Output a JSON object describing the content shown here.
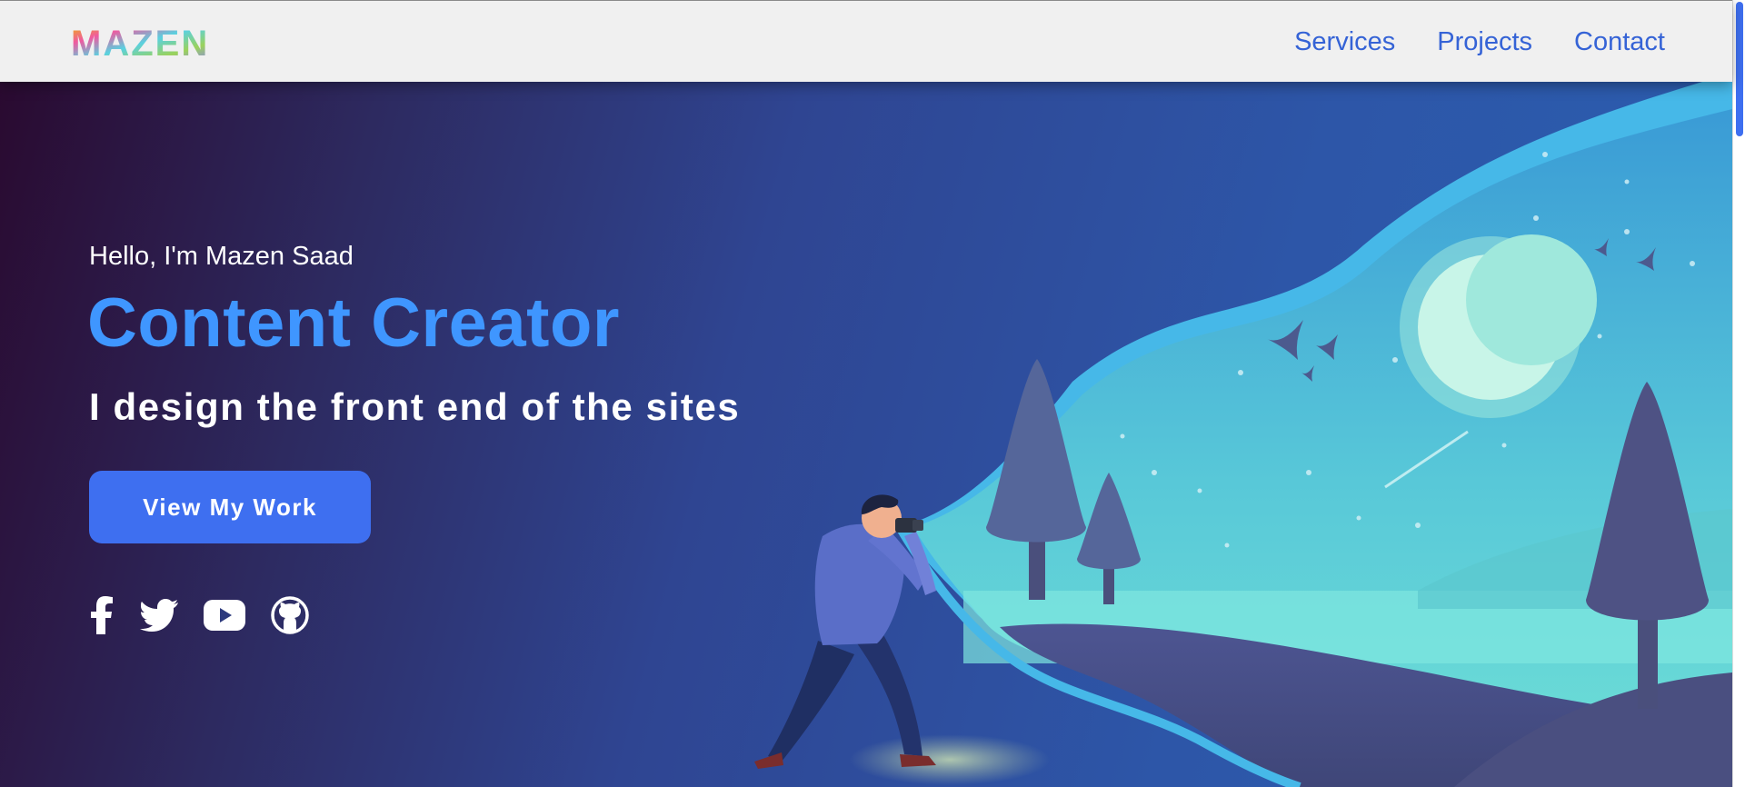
{
  "brand": {
    "logo_text": "MAZEN",
    "logo_colors": [
      "#f2b705",
      "#ef5aa0",
      "#5ad1e0",
      "#9bd25a",
      "#8a7cff"
    ]
  },
  "nav": {
    "links": [
      "Services",
      "Projects",
      "Contact"
    ]
  },
  "hero": {
    "greeting": "Hello, I'm Mazen Saad",
    "headline": "Content Creator",
    "tagline": "I design the front end of the sites",
    "cta_label": "View My Work"
  },
  "social_icons": [
    "facebook-icon",
    "twitter-icon",
    "youtube-icon",
    "github-icon"
  ],
  "colors": {
    "nav_link": "#3563d6",
    "headline": "#3f96ff",
    "button": "#3e6ff0",
    "nav_background": "#f0f0f0"
  }
}
